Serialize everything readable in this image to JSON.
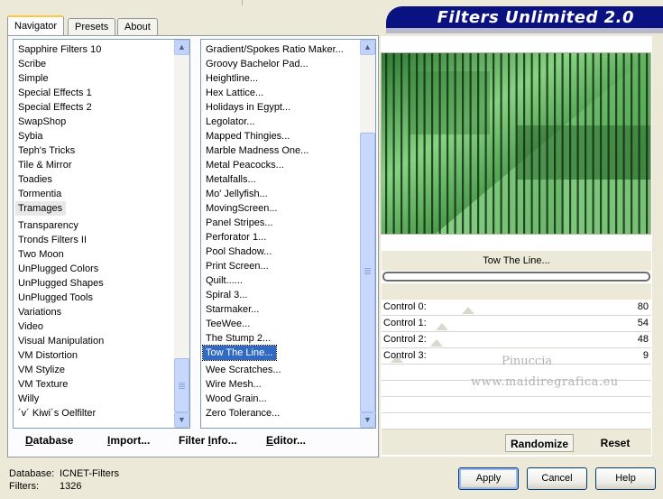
{
  "tabs": [
    "Navigator",
    "Presets",
    "About"
  ],
  "banner_title": "Filters Unlimited 2.0",
  "categories": {
    "items": [
      "Sapphire Filters 10",
      "Scribe",
      "Simple",
      "Special Effects 1",
      "Special Effects 2",
      "SwapShop",
      "Sybia",
      "Teph's Tricks",
      "Tile & Mirror",
      "Toadies",
      "Tormentia",
      "Tramages",
      "Transparency",
      "Tronds Filters II",
      "Two Moon",
      "UnPlugged Colors",
      "UnPlugged Shapes",
      "UnPlugged Tools",
      "Variations",
      "Video",
      "Visual Manipulation",
      "VM Distortion",
      "VM Stylize",
      "VM Texture",
      "Willy",
      "´v´ Kiwi´s Oelfilter"
    ],
    "selected": "Tramages"
  },
  "filters": {
    "items": [
      "Gradient/Spokes Ratio Maker...",
      "Groovy Bachelor Pad...",
      "Heightline...",
      "Hex Lattice...",
      "Holidays in Egypt...",
      "Legolator...",
      "Mapped Thingies...",
      "Marble Madness One...",
      "Metal Peacocks...",
      "Metalfalls...",
      "Mo' Jellyfish...",
      "MovingScreen...",
      "Panel Stripes...",
      "Perforator 1...",
      "Pool Shadow...",
      "Print Screen...",
      "Quilt......",
      "Spiral 3...",
      "Starmaker...",
      "TeeWee...",
      "The Stump 2...",
      "Tow The Line...",
      "Wee Scratches...",
      "Wire Mesh...",
      "Wood Grain...",
      "Zero Tolerance..."
    ],
    "selected": "Tow The Line..."
  },
  "panel_buttons": {
    "database": {
      "u": "D",
      "rest": "atabase"
    },
    "import": {
      "u": "I",
      "rest": "mport..."
    },
    "filter_info": {
      "pre": "Filter ",
      "u": "I",
      "rest": "nfo..."
    },
    "editor": {
      "u": "E",
      "rest": "ditor..."
    }
  },
  "current_filter": "Tow The Line...",
  "controls": [
    {
      "label": "Control 0:",
      "value": "80",
      "level": 80
    },
    {
      "label": "Control 1:",
      "value": "54",
      "level": 54
    },
    {
      "label": "Control 2:",
      "value": "48",
      "level": 48
    },
    {
      "label": "Control 3:",
      "value": "9",
      "level": 9
    }
  ],
  "watermark": {
    "line1": "Pinuccia",
    "line2": "www.maidiregrafica.eu"
  },
  "randomize_label": "Randomize",
  "reset_label": "Reset",
  "status": {
    "database_label": "Database:",
    "database_value": "ICNET-Filters",
    "filters_label": "Filters:",
    "filters_value": "1326"
  },
  "buttons": {
    "apply": "Apply",
    "cancel": "Cancel",
    "help": "Help"
  },
  "colors": {
    "banner": "#0a1180",
    "selection": "#316ac5",
    "preview_green": "#6fbf6a"
  }
}
